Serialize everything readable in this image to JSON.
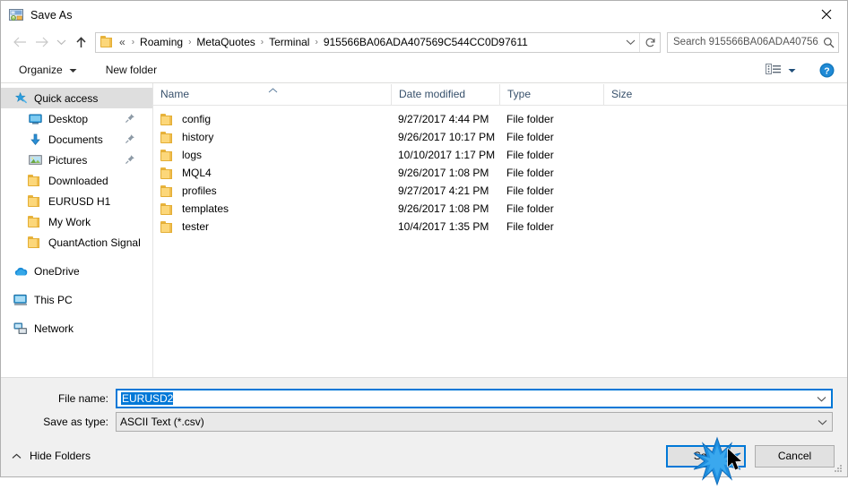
{
  "window": {
    "title": "Save As",
    "icon": "save-as-app-icon",
    "close_label": "×"
  },
  "nav": {
    "back_icon": "arrow-left-icon",
    "forward_icon": "arrow-right-icon",
    "recent_icon": "chevron-down-icon",
    "up_icon": "arrow-up-icon",
    "address": {
      "folder_icon": "folder-icon",
      "prefix": "«",
      "crumbs": [
        "Roaming",
        "MetaQuotes",
        "Terminal",
        "915566BA06ADA407569C544CC0D97611"
      ],
      "separator": "›",
      "dropdown_icon": "chevron-down-icon",
      "refresh_icon": "refresh-icon"
    },
    "search": {
      "placeholder": "Search 915566BA06ADA40756...",
      "icon": "search-icon"
    }
  },
  "toolbar": {
    "organize_label": "Organize",
    "organize_caret": "chevron-down-icon",
    "new_folder_label": "New folder",
    "view_icon": "view-layout-icon",
    "view_caret": "chevron-down-icon",
    "help_icon": "help-icon"
  },
  "sidebar": {
    "items": [
      {
        "label": "Quick access",
        "icon": "star-pin-icon",
        "selected": true,
        "indent": false,
        "pinned": false
      },
      {
        "label": "Desktop",
        "icon": "desktop-icon",
        "selected": false,
        "indent": true,
        "pinned": true
      },
      {
        "label": "Documents",
        "icon": "documents-icon",
        "selected": false,
        "indent": true,
        "pinned": true
      },
      {
        "label": "Pictures",
        "icon": "pictures-icon",
        "selected": false,
        "indent": true,
        "pinned": true
      },
      {
        "label": "Downloaded",
        "icon": "folder-icon",
        "selected": false,
        "indent": true,
        "pinned": false
      },
      {
        "label": "EURUSD H1",
        "icon": "folder-icon",
        "selected": false,
        "indent": true,
        "pinned": false
      },
      {
        "label": "My Work",
        "icon": "folder-icon",
        "selected": false,
        "indent": true,
        "pinned": false
      },
      {
        "label": "QuantAction Signal",
        "icon": "folder-icon",
        "selected": false,
        "indent": true,
        "pinned": false
      },
      {
        "label": "OneDrive",
        "icon": "onedrive-icon",
        "selected": false,
        "indent": false,
        "pinned": false
      },
      {
        "label": "This PC",
        "icon": "this-pc-icon",
        "selected": false,
        "indent": false,
        "pinned": false
      },
      {
        "label": "Network",
        "icon": "network-icon",
        "selected": false,
        "indent": false,
        "pinned": false
      }
    ]
  },
  "filelist": {
    "columns": {
      "name": "Name",
      "date_modified": "Date modified",
      "type": "Type",
      "size": "Size"
    },
    "sort_column": "Name",
    "sort_direction": "ascending",
    "sort_icon": "caret-up-icon",
    "rows": [
      {
        "name": "config",
        "date": "9/27/2017 4:44 PM",
        "type": "File folder",
        "size": "",
        "icon": "folder-icon"
      },
      {
        "name": "history",
        "date": "9/26/2017 10:17 PM",
        "type": "File folder",
        "size": "",
        "icon": "folder-icon"
      },
      {
        "name": "logs",
        "date": "10/10/2017 1:17 PM",
        "type": "File folder",
        "size": "",
        "icon": "folder-icon"
      },
      {
        "name": "MQL4",
        "date": "9/26/2017 1:08 PM",
        "type": "File folder",
        "size": "",
        "icon": "folder-icon"
      },
      {
        "name": "profiles",
        "date": "9/27/2017 4:21 PM",
        "type": "File folder",
        "size": "",
        "icon": "folder-icon"
      },
      {
        "name": "templates",
        "date": "9/26/2017 1:08 PM",
        "type": "File folder",
        "size": "",
        "icon": "folder-icon"
      },
      {
        "name": "tester",
        "date": "10/4/2017 1:35 PM",
        "type": "File folder",
        "size": "",
        "icon": "folder-icon"
      }
    ]
  },
  "form": {
    "filename_label": "File name:",
    "filename_value": "EURUSD2",
    "filename_selected": true,
    "savetype_label": "Save as type:",
    "savetype_value": "ASCII Text (*.csv)",
    "dropdown_icon": "chevron-down-icon"
  },
  "footer": {
    "hide_folders_label": "Hide Folders",
    "hide_folders_icon": "caret-up-icon",
    "save_label": "Save",
    "cancel_label": "Cancel",
    "resize_grip_icon": "resize-grip-icon"
  },
  "pointer": {
    "click_effect_icon": "click-burst-icon",
    "cursor_icon": "mouse-pointer-icon",
    "target": "Save"
  },
  "colors": {
    "accent": "#0078d7",
    "selection": "#dedede",
    "folder": "#fcd77a",
    "column_header_text": "#37506b",
    "dialog_bg": "#f0f0f0"
  }
}
